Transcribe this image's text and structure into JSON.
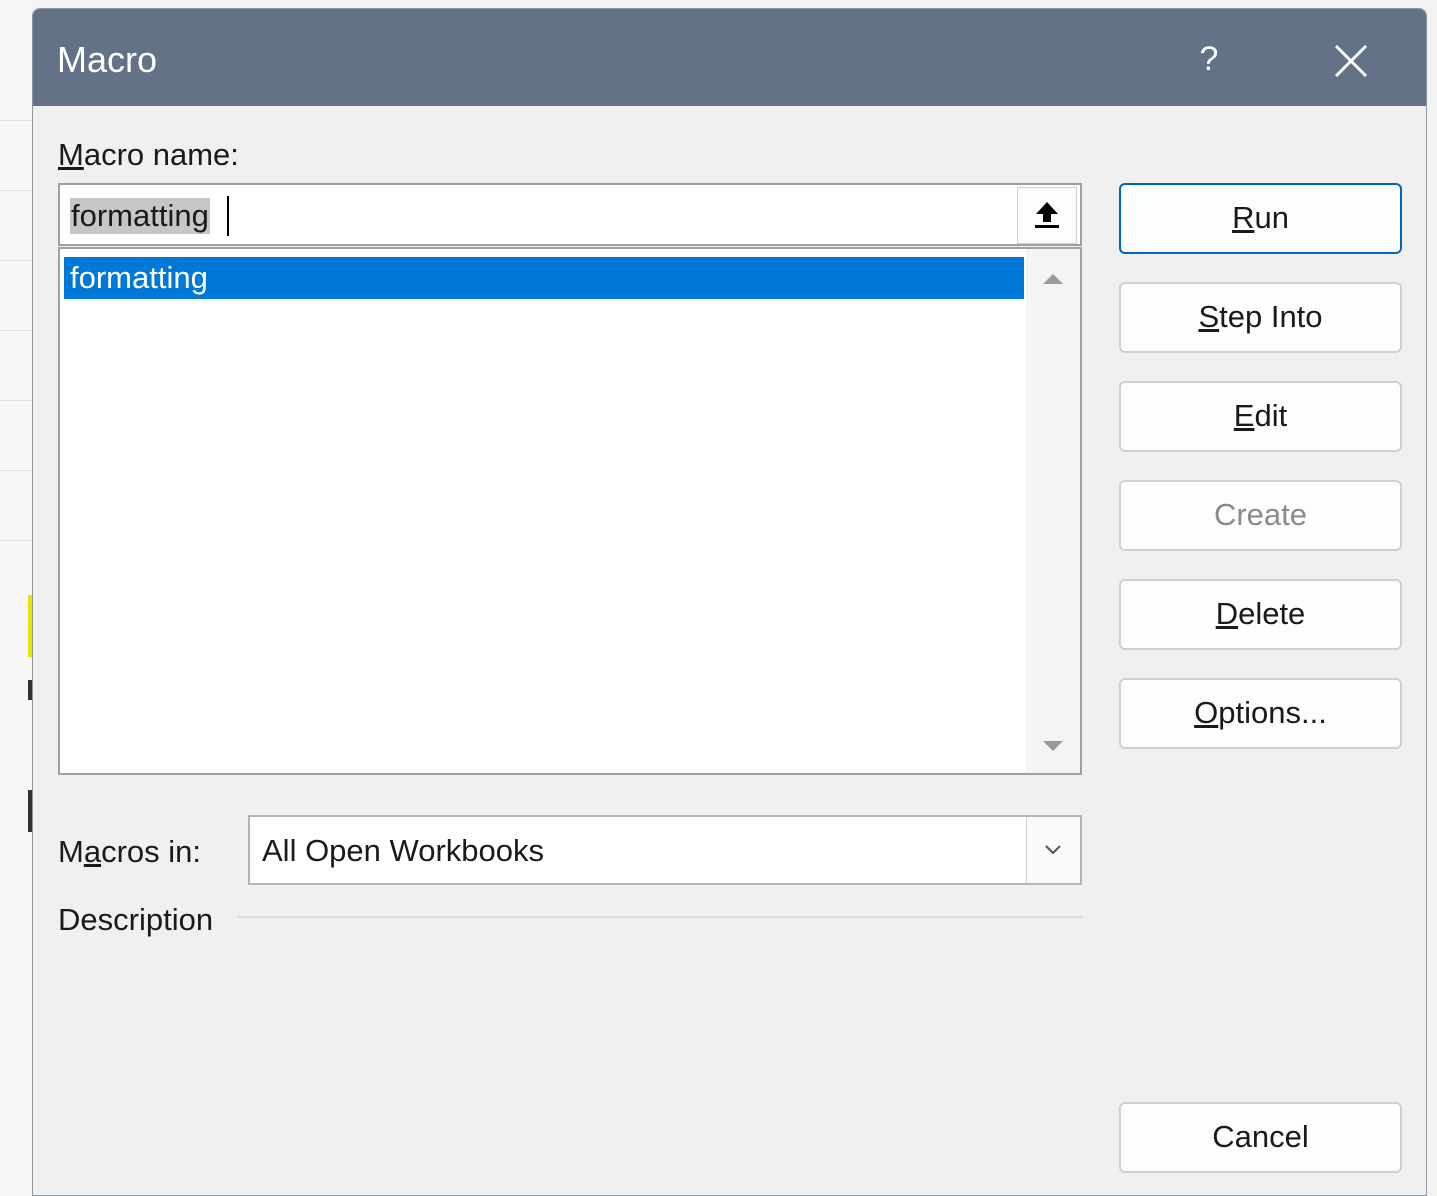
{
  "dialog": {
    "title": "Macro",
    "help_label": "?"
  },
  "macro_name": {
    "label_underlined": "M",
    "label_rest": "acro name:",
    "value": "formatting"
  },
  "macro_list": {
    "items": [
      "formatting"
    ],
    "selected_index": 0
  },
  "buttons": {
    "run": {
      "underlined": "R",
      "rest": "un"
    },
    "step_into": {
      "underlined": "S",
      "rest": "tep Into"
    },
    "edit": {
      "underlined": "E",
      "rest": "dit"
    },
    "create": {
      "label": "Create"
    },
    "delete": {
      "underlined": "D",
      "rest": "elete"
    },
    "options": {
      "underlined": "O",
      "rest": "ptions..."
    },
    "cancel": {
      "label": "Cancel"
    }
  },
  "macros_in": {
    "label_pre": "M",
    "label_underlined": "a",
    "label_rest": "cros in:",
    "value": "All Open Workbooks"
  },
  "description": {
    "label": "Description"
  },
  "colors": {
    "titlebar": "#637286",
    "selection": "#0078d7",
    "default_button_border": "#0067c0"
  }
}
